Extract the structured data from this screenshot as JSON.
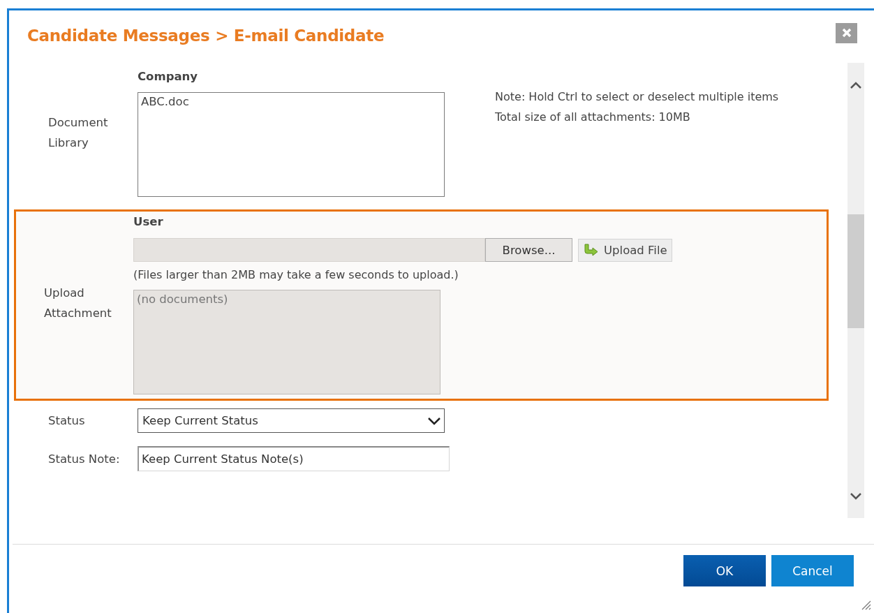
{
  "dialog": {
    "title": "Candidate Messages > E-mail Candidate"
  },
  "fields": [
    {
      "kind": "library",
      "label": "Document Library",
      "heading": "Company",
      "items": [
        "ABC.doc"
      ],
      "notes": [
        "Note: Hold Ctrl to select or deselect multiple items",
        "Total size of all attachments: 10MB"
      ]
    },
    {
      "kind": "upload",
      "label": "Upload Attachment",
      "heading": "User",
      "highlighted": true,
      "browse_button": "Browse...",
      "upload_button": "Upload File",
      "hint": "(Files larger than 2MB may take a few seconds to upload.)",
      "empty_text": "(no documents)"
    },
    {
      "kind": "select",
      "label": "Status",
      "value": "Keep Current Status"
    },
    {
      "kind": "text",
      "label": "Status Note:",
      "value": "Keep Current Status Note(s)"
    }
  ],
  "buttons": [
    {
      "label": "OK",
      "kind": "primary"
    },
    {
      "label": "Cancel",
      "kind": "secondary"
    }
  ]
}
